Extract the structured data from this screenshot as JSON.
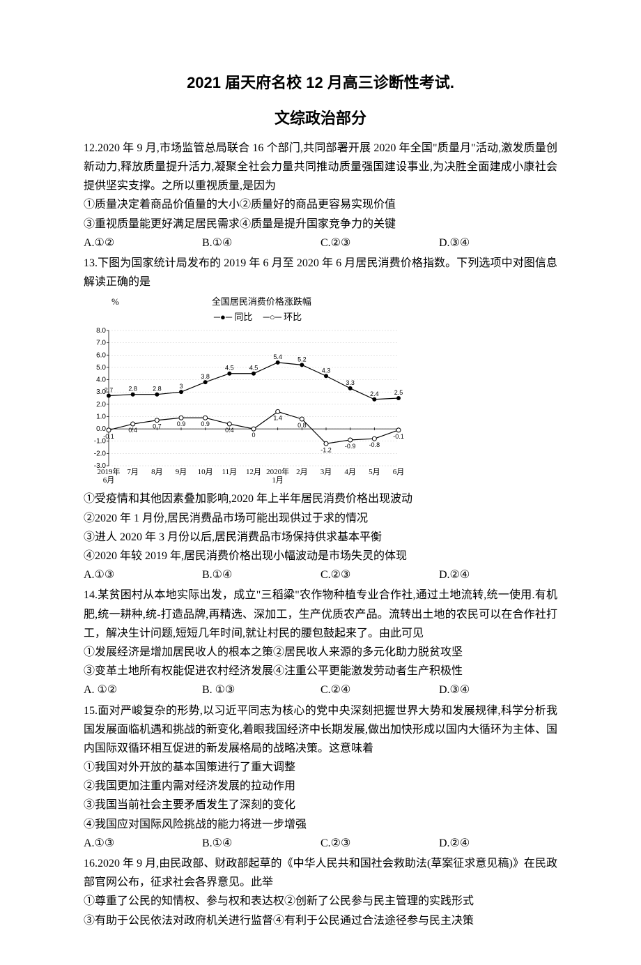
{
  "title": "2021 届天府名校 12 月高三诊断性考试.",
  "subtitle": "文综政治部分",
  "q12": {
    "text": "12.2020 年 9 月,市场监管总局联合 16 个部门,共同部署开展 2020 年全国\"质量月\"活动,激发质量创新动力,释放质量提升活力,凝聚全社会力量共同推动质量强国建设事业,为决胜全面建成小康社会提供坚实支撑。之所以重视质量,是因为",
    "s1": "①质量决定着商品价值量的大小②质量好的商品更容易实现价值",
    "s2": "③重视质量能更好满足居民需求④质量是提升国家竞争力的关键",
    "a": "A.①②",
    "b": "B.①④",
    "c": "C.②③",
    "d": "D.③④"
  },
  "q13": {
    "text": "13.下图为国家统计局发布的 2019 年 6 月至 2020 年 6 月居民消费价格指数。下列选项中对图信息解读正确的是",
    "s1": "①受疫情和其他因素叠加影响,2020 年上半年居民消费价格出现波动",
    "s2": "②2020 年 1 月份,居民消费品市场可能出现供过于求的情况",
    "s3": "③进人 2020 年 3 月份以后,居民消费品市场保持供求基本平衡",
    "s4": "④2020 年较 2019 年,居民消费价格出现小幅波动是市场失灵的体现",
    "a": "A.①③",
    "b": "B.①④",
    "c": "C.②③",
    "d": "D.②④"
  },
  "q14": {
    "text": "14.某贫困村从本地实际出发，成立\"三稻粱\"农作物种植专业合作社,通过土地流转,统一使用.有机肥,统一耕种,统-打造品牌,再精选、深加工，生产优质农产品。流转出土地的农民可以在合作社打工，解决生计问题,短短几年时间,就让村民的腰包鼓起来了。由此可见",
    "s1": "①发展经济是增加居民收人的根本之策②居民收人来源的多元化助力脱贫攻坚",
    "s2": "③变革土地所有权能促进农村经济发展④注重公平更能激发劳动者生产积极性",
    "a": "A. ①②",
    "b": "B. ①③",
    "c": "C.②④",
    "d": "D.③④"
  },
  "q15": {
    "text": "15.面对严峻复杂的形势,以习近平同志为核心的党中央深刻把握世界大势和发展规律,科学分析我国发展面临机遇和挑战的新变化,着眼我国经济中长期发展,做出加快形成以国内大循环为主体、国内国际双循环相互促进的新发展格局的战略决策。这意味着",
    "s1": "①我国对外开放的基本国策进行了重大调整",
    "s2": "②我国更加注重内需对经济发展的拉动作用",
    "s3": "③我国当前社会主要矛盾发生了深刻的变化",
    "s4": "④我国应对国际风险挑战的能力将进一步增强",
    "a": "A.①③",
    "b": "B.①④",
    "c": "C.②③",
    "d": "D.②④"
  },
  "q16": {
    "text": "16.2020 年 9 月,由民政部、财政部起草的《中华人民共和国社会救助法(草案征求意见稿)》在民政部官网公布，征求社会各界意见。此举",
    "s1": "①尊重了公民的知情权、参与权和表达权②创新了公民参与民主管理的实践形式",
    "s2": "③有助于公民依法对政府机关进行监督④有利于公民通过合法途径参与民主决策"
  },
  "chart_data": {
    "type": "line",
    "title": "全国居民消费价格涨跌幅",
    "ylabel": "%",
    "ylim": [
      -3,
      8
    ],
    "yticks": [
      -3,
      -2,
      -1,
      0,
      1,
      2,
      3,
      4,
      5,
      6,
      7,
      8
    ],
    "categories": [
      "2019年6月",
      "7月",
      "8月",
      "9月",
      "10月",
      "11月",
      "12月",
      "2020年1月",
      "2月",
      "3月",
      "4月",
      "5月",
      "6月"
    ],
    "series": [
      {
        "name": "同比",
        "marker": "solid",
        "values": [
          2.7,
          2.8,
          2.8,
          3.0,
          3.8,
          4.5,
          4.5,
          5.4,
          5.2,
          4.3,
          3.3,
          2.4,
          2.5
        ]
      },
      {
        "name": "环比",
        "marker": "open",
        "values": [
          -0.1,
          0.4,
          0.7,
          0.9,
          0.9,
          0.4,
          0.0,
          1.4,
          0.8,
          -1.2,
          -0.9,
          -0.8,
          -0.1
        ]
      }
    ],
    "legend": {
      "tongbi": "同比",
      "huanbi": "环比"
    }
  }
}
